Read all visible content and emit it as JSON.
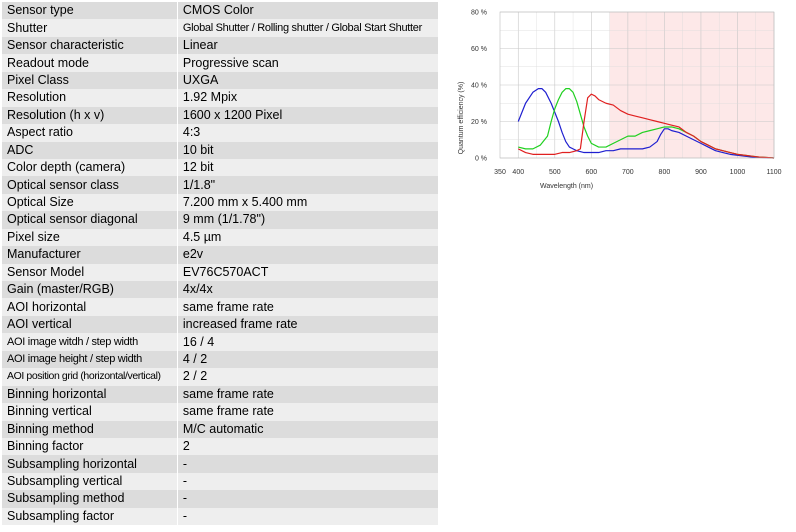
{
  "specs": [
    {
      "label": "Sensor type",
      "value": "CMOS Color"
    },
    {
      "label": "Shutter",
      "value": "Global Shutter / Rolling shutter / Global Start Shutter"
    },
    {
      "label": "Sensor characteristic",
      "value": "Linear"
    },
    {
      "label": "Readout mode",
      "value": "Progressive scan"
    },
    {
      "label": "Pixel Class",
      "value": "UXGA"
    },
    {
      "label": "Resolution",
      "value": "1.92 Mpix"
    },
    {
      "label": "Resolution (h x v)",
      "value": "1600 x 1200 Pixel"
    },
    {
      "label": "Aspect ratio",
      "value": "4:3"
    },
    {
      "label": "ADC",
      "value": "10 bit"
    },
    {
      "label": "Color depth (camera)",
      "value": "12 bit"
    },
    {
      "label": "Optical sensor class",
      "value": "1/1.8\""
    },
    {
      "label": "Optical Size",
      "value": "7.200 mm x 5.400 mm"
    },
    {
      "label": "Optical sensor diagonal",
      "value": "9 mm (1/1.78\")"
    },
    {
      "label": "Pixel size",
      "value": "4.5 µm"
    },
    {
      "label": "Manufacturer",
      "value": "e2v"
    },
    {
      "label": "Sensor Model",
      "value": "EV76C570ACT"
    },
    {
      "label": "Gain (master/RGB)",
      "value": "4x/4x"
    },
    {
      "label": "AOI horizontal",
      "value": "same frame rate"
    },
    {
      "label": "AOI vertical",
      "value": "increased frame rate"
    },
    {
      "label": "AOI image witdh / step width",
      "value": "16 / 4"
    },
    {
      "label": "AOI image height / step width",
      "value": "4 / 2"
    },
    {
      "label": "AOI position grid (horizontal/vertical)",
      "value": "2 / 2"
    },
    {
      "label": "Binning horizontal",
      "value": "same frame rate"
    },
    {
      "label": "Binning vertical",
      "value": "same frame rate"
    },
    {
      "label": "Binning method",
      "value": "M/C automatic"
    },
    {
      "label": "Binning factor",
      "value": "2"
    },
    {
      "label": "Subsampling horizontal",
      "value": "-"
    },
    {
      "label": "Subsampling vertical",
      "value": "-"
    },
    {
      "label": "Subsampling method",
      "value": "-"
    },
    {
      "label": "Subsampling factor",
      "value": "-"
    }
  ],
  "chart_data": {
    "type": "line",
    "xlabel": "Wavelength (nm)",
    "ylabel": "Quantum efficiency (%)",
    "xlim": [
      350,
      1100
    ],
    "ylim": [
      0,
      80
    ],
    "x_ticks": [
      "350",
      "400",
      "500",
      "600",
      "700",
      "800",
      "900",
      "1000",
      "1100"
    ],
    "y_ticks": [
      "0 %",
      "20 %",
      "40 %",
      "60 %",
      "80 %"
    ],
    "grid": true,
    "highlight_region": {
      "from": 650,
      "to": 1100,
      "color": "#fde8e8"
    },
    "series": [
      {
        "color": "#1f1fd0",
        "points": [
          [
            400,
            20
          ],
          [
            410,
            25
          ],
          [
            420,
            30
          ],
          [
            440,
            36
          ],
          [
            455,
            38
          ],
          [
            465,
            38
          ],
          [
            475,
            36
          ],
          [
            490,
            30
          ],
          [
            500,
            25
          ],
          [
            510,
            20
          ],
          [
            520,
            14
          ],
          [
            530,
            9
          ],
          [
            540,
            6
          ],
          [
            550,
            5
          ],
          [
            560,
            4
          ],
          [
            580,
            3
          ],
          [
            600,
            3
          ],
          [
            620,
            3
          ],
          [
            640,
            4
          ],
          [
            660,
            4
          ],
          [
            680,
            5
          ],
          [
            700,
            5
          ],
          [
            720,
            5
          ],
          [
            740,
            5
          ],
          [
            760,
            6
          ],
          [
            780,
            9
          ],
          [
            790,
            13
          ],
          [
            800,
            16
          ],
          [
            810,
            16
          ],
          [
            820,
            15
          ],
          [
            840,
            14
          ],
          [
            860,
            12
          ],
          [
            880,
            10
          ],
          [
            900,
            8
          ],
          [
            920,
            6
          ],
          [
            940,
            4
          ],
          [
            960,
            3
          ],
          [
            980,
            2
          ],
          [
            1000,
            1.5
          ],
          [
            1020,
            1
          ],
          [
            1040,
            0.5
          ],
          [
            1060,
            0.3
          ],
          [
            1080,
            0.2
          ],
          [
            1100,
            0
          ]
        ]
      },
      {
        "color": "#20d020",
        "points": [
          [
            400,
            6
          ],
          [
            420,
            5
          ],
          [
            440,
            5
          ],
          [
            460,
            7
          ],
          [
            480,
            12
          ],
          [
            490,
            20
          ],
          [
            500,
            27
          ],
          [
            510,
            32
          ],
          [
            520,
            36
          ],
          [
            530,
            38
          ],
          [
            540,
            38
          ],
          [
            550,
            36
          ],
          [
            560,
            31
          ],
          [
            570,
            24
          ],
          [
            580,
            17
          ],
          [
            590,
            12
          ],
          [
            600,
            8
          ],
          [
            620,
            6
          ],
          [
            640,
            6
          ],
          [
            660,
            8
          ],
          [
            680,
            10
          ],
          [
            700,
            12
          ],
          [
            720,
            12
          ],
          [
            740,
            14
          ],
          [
            760,
            15
          ],
          [
            780,
            16
          ],
          [
            800,
            17
          ],
          [
            820,
            17
          ],
          [
            840,
            16
          ],
          [
            860,
            14
          ],
          [
            880,
            12
          ],
          [
            900,
            9
          ],
          [
            920,
            7
          ],
          [
            940,
            5
          ],
          [
            960,
            4
          ],
          [
            980,
            3
          ],
          [
            1000,
            2
          ],
          [
            1020,
            1.5
          ],
          [
            1040,
            1
          ],
          [
            1060,
            0.5
          ],
          [
            1080,
            0.3
          ],
          [
            1100,
            0
          ]
        ]
      },
      {
        "color": "#e02020",
        "points": [
          [
            400,
            5
          ],
          [
            420,
            3
          ],
          [
            440,
            2
          ],
          [
            460,
            2
          ],
          [
            480,
            2
          ],
          [
            500,
            2
          ],
          [
            520,
            3
          ],
          [
            540,
            3
          ],
          [
            560,
            4
          ],
          [
            570,
            5
          ],
          [
            580,
            20
          ],
          [
            590,
            33
          ],
          [
            600,
            35
          ],
          [
            610,
            34
          ],
          [
            620,
            32
          ],
          [
            640,
            30
          ],
          [
            660,
            29
          ],
          [
            680,
            26
          ],
          [
            700,
            24
          ],
          [
            720,
            23
          ],
          [
            740,
            22
          ],
          [
            760,
            21
          ],
          [
            780,
            20
          ],
          [
            800,
            19
          ],
          [
            820,
            18
          ],
          [
            840,
            17
          ],
          [
            860,
            14
          ],
          [
            880,
            12
          ],
          [
            900,
            9
          ],
          [
            920,
            7
          ],
          [
            940,
            5
          ],
          [
            960,
            4
          ],
          [
            980,
            3
          ],
          [
            1000,
            2
          ],
          [
            1020,
            1.5
          ],
          [
            1040,
            1
          ],
          [
            1060,
            0.5
          ],
          [
            1080,
            0.3
          ],
          [
            1100,
            0
          ]
        ]
      }
    ]
  }
}
